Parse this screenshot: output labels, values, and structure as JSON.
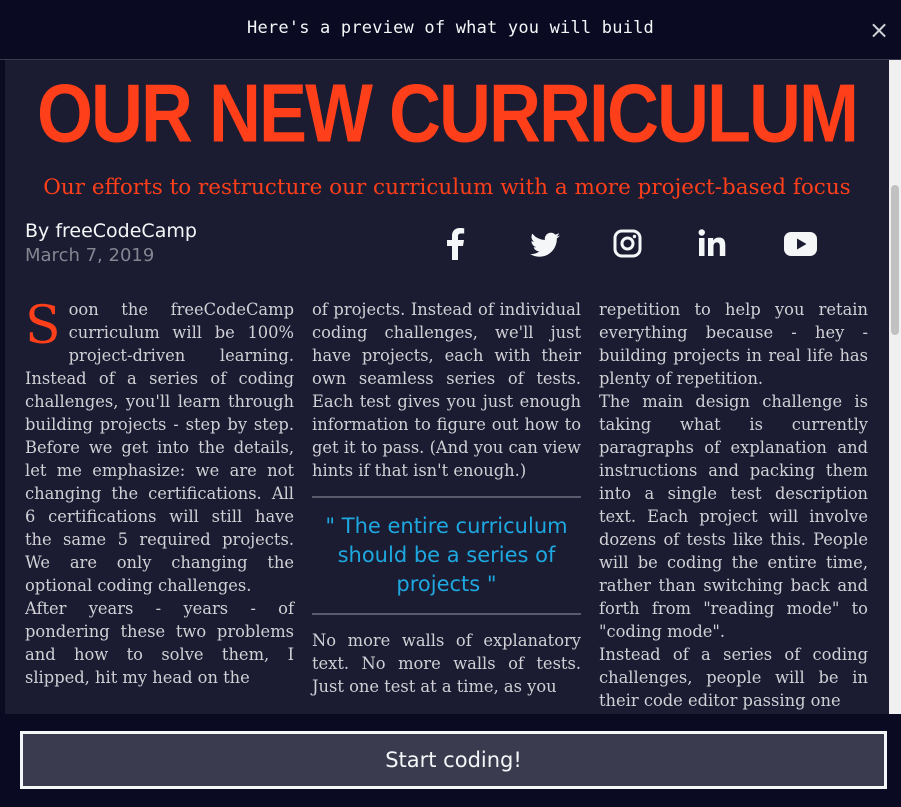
{
  "modal": {
    "title": "Here's a preview of what you will build",
    "close_label": "×"
  },
  "article": {
    "headline": "OUR NEW CURRICULUM",
    "subheadline": "Our efforts to restructure our curriculum with a more project-based focus",
    "author": "By freeCodeCamp",
    "date": "March 7, 2019",
    "social_icons": [
      "facebook-icon",
      "twitter-icon",
      "instagram-icon",
      "linkedin-icon",
      "youtube-icon"
    ],
    "col1": {
      "dropcap": "S",
      "p1": "oon the freeCodeCamp curriculum will be 100% project-driven learning. Instead of a series of coding challenges, you'll learn through building projects - step by step. Before we get into the details, let me emphasize: we are not changing the certifications. All 6 certifications will still have the same 5 required projects. We are only changing the optional coding challenges.",
      "p2": "After years - years - of pondering these two problems and how to solve them, I slipped, hit my head on the"
    },
    "col2": {
      "p1": "of projects. Instead of individual coding challenges, we'll just have projects, each with their own seamless series of tests. Each test gives you just enough information to figure out how to get it to pass. (And you can view hints if that isn't enough.)",
      "quote": "\" The entire curriculum should be a series of projects \"",
      "p2": "No more walls of explanatory text. No more walls of tests. Just one test at a time, as you"
    },
    "col3": {
      "p1": "repetition to help you retain everything because - hey - building projects in real life has plenty of repetition.",
      "p2": "The main design challenge is taking what is currently paragraphs of explanation and instructions and packing them into a single test description text. Each project will involve dozens of tests like this. People will be coding the entire time, rather than switching back and forth from \"reading mode\" to \"coding mode\".",
      "p3": "Instead of a series of coding challenges, people will be in their code editor passing one"
    }
  },
  "footer": {
    "start_button": "Start coding!"
  },
  "colors": {
    "accent": "#ff3f1a",
    "quote": "#1ea8e0",
    "background": "#1b1b32",
    "chrome": "#0a0a23"
  }
}
